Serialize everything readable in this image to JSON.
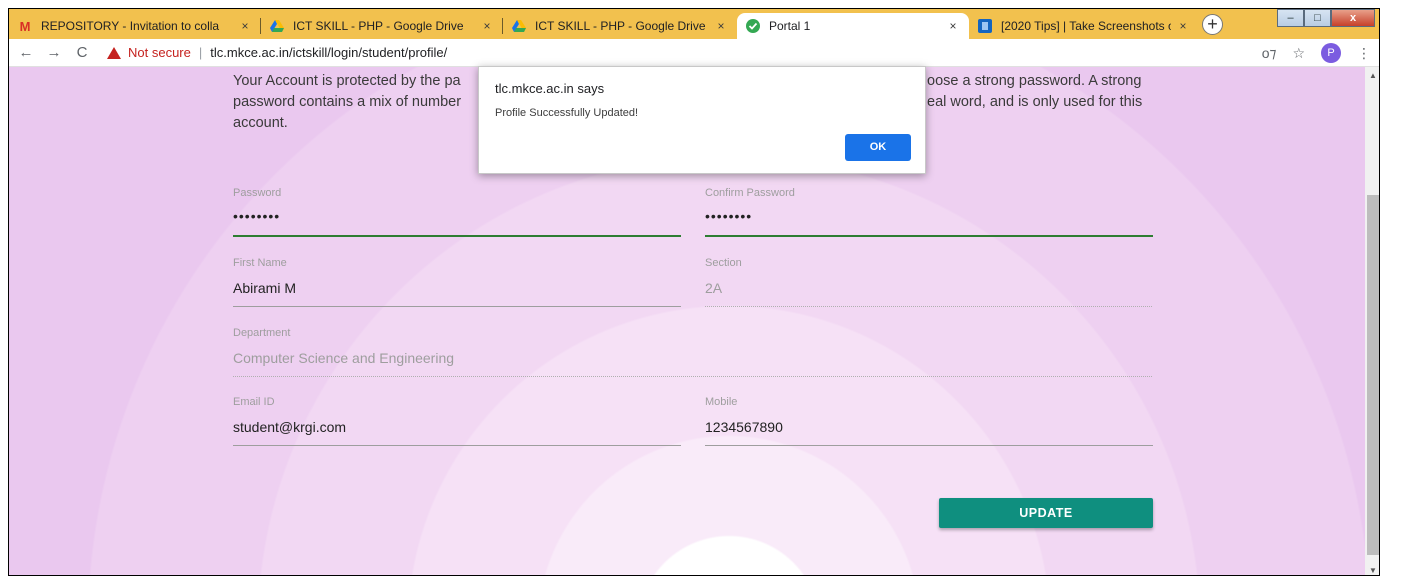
{
  "tabs": [
    {
      "label": "REPOSITORY - Invitation to colla",
      "icon": "gmail-icon",
      "icon_color": "#d93025"
    },
    {
      "label": "ICT SKILL - PHP - Google Drive",
      "icon": "google-drive-icon",
      "icon_color": "#1a73e8"
    },
    {
      "label": "ICT SKILL - PHP - Google Drive",
      "icon": "google-drive-icon",
      "icon_color": "#1a73e8"
    },
    {
      "label": "Portal 1",
      "icon": "check-circle-icon",
      "icon_color": "#34a853"
    },
    {
      "label": "[2020 Tips] | Take Screenshots o",
      "icon": "site-icon",
      "icon_color": "#1565c0"
    }
  ],
  "tab_close": "×",
  "new_tab": "+",
  "window_buttons": {
    "minimize": "–",
    "maximize": "□",
    "close": "x"
  },
  "toolbar": {
    "back": "←",
    "forward": "→",
    "reload": "C",
    "security_label": "Not secure",
    "separator": "|",
    "url": "tlc.mkce.ac.in/ictskill/login/student/profile/",
    "key_icon": "o⁊",
    "star_icon": "☆",
    "avatar_letter": "P",
    "menu_icon": "⋮"
  },
  "notice": {
    "line1_left": "Your Account is protected by the pa",
    "line1_right": "oose a strong password. A strong",
    "line2_left": "password contains a mix of number",
    "line2_right": "eal word, and is only used for this",
    "line3": "account."
  },
  "form": {
    "password": {
      "label": "Password",
      "value": "••••••••"
    },
    "confirm_password": {
      "label": "Confirm Password",
      "value": "••••••••"
    },
    "first_name": {
      "label": "First Name",
      "value": "Abirami M"
    },
    "section": {
      "label": "Section",
      "value": "2A"
    },
    "department": {
      "label": "Department",
      "value": "Computer Science and Engineering"
    },
    "email": {
      "label": "Email ID",
      "value": "student@krgi.com"
    },
    "mobile": {
      "label": "Mobile",
      "value": "1234567890"
    },
    "update_label": "UPDATE"
  },
  "dialog": {
    "title": "tlc.mkce.ac.in says",
    "message": "Profile Successfully Updated!",
    "ok_label": "OK"
  },
  "colors": {
    "tabstrip": "#f2c14e",
    "accent_green": "#2e7d32",
    "update_button": "#0f8f7f",
    "ok_button": "#1a73e8",
    "insecure_red": "#c5221f"
  }
}
